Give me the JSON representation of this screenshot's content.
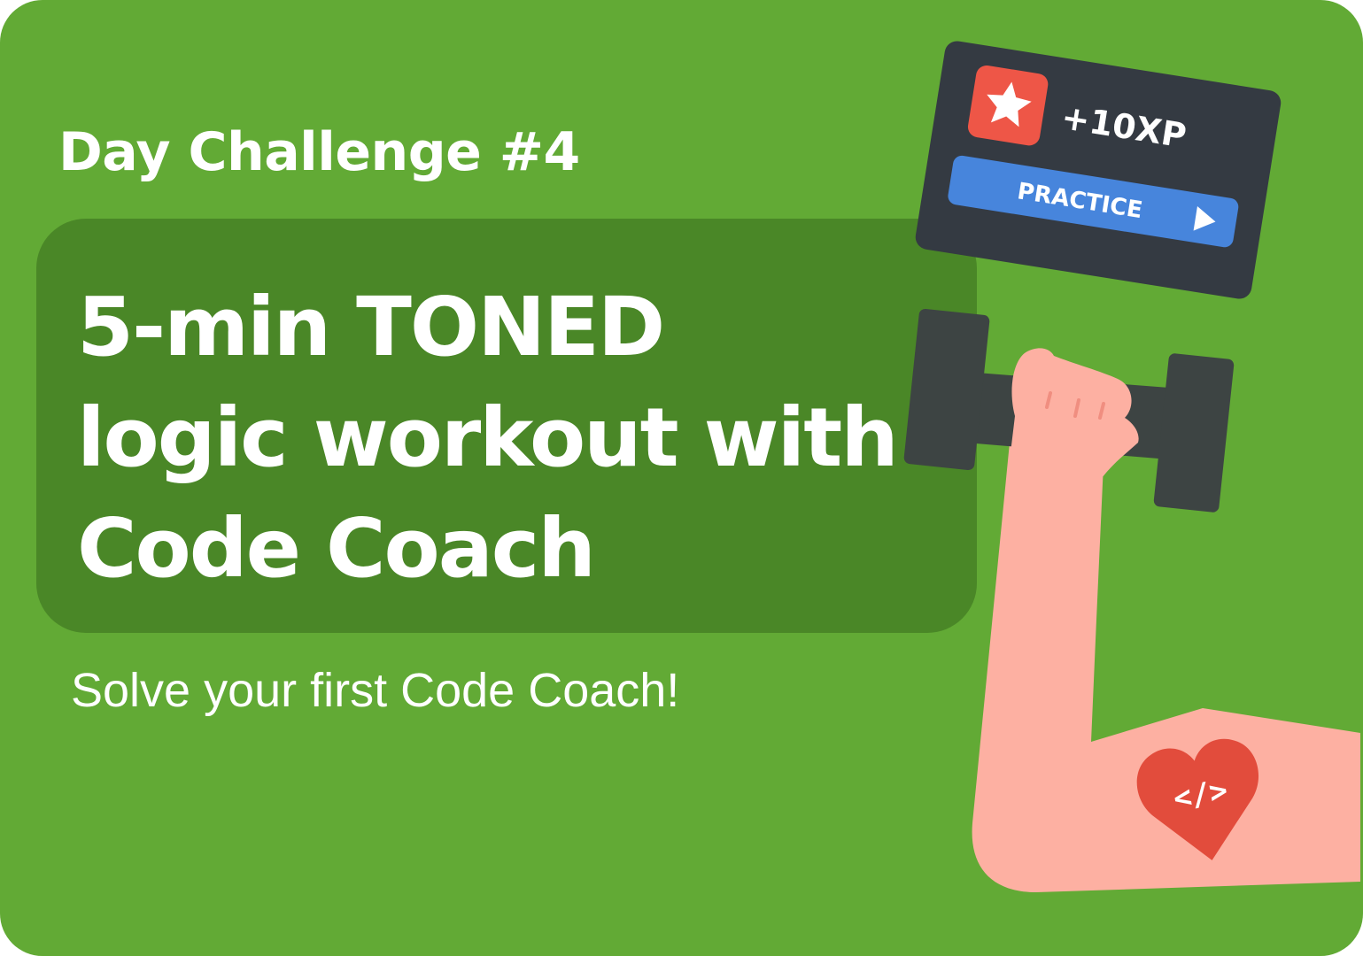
{
  "card": {
    "eyebrow": "Day Challenge #4",
    "headline_lines": [
      "5-min TONED",
      "logic workout with",
      "Code Coach"
    ],
    "subtitle": "Solve your first Code Coach!"
  },
  "reward_card": {
    "icon": "star-icon",
    "xp_label": "+10XP",
    "practice_label": "PRACTICE",
    "practice_icon": "play-icon"
  },
  "illustration": {
    "equipment": "dumbbell-icon",
    "tattoo_icon": "heart-code-icon",
    "tattoo_symbol": "</>"
  },
  "colors": {
    "background": "#62aa35",
    "headline_box": "#4a8727",
    "reward_card": "#343a42",
    "star_tile": "#ee5647",
    "practice_button": "#4785dc",
    "dumbbell": "#3d4443",
    "skin": "#fdb0a2",
    "heart": "#e24c3c"
  }
}
